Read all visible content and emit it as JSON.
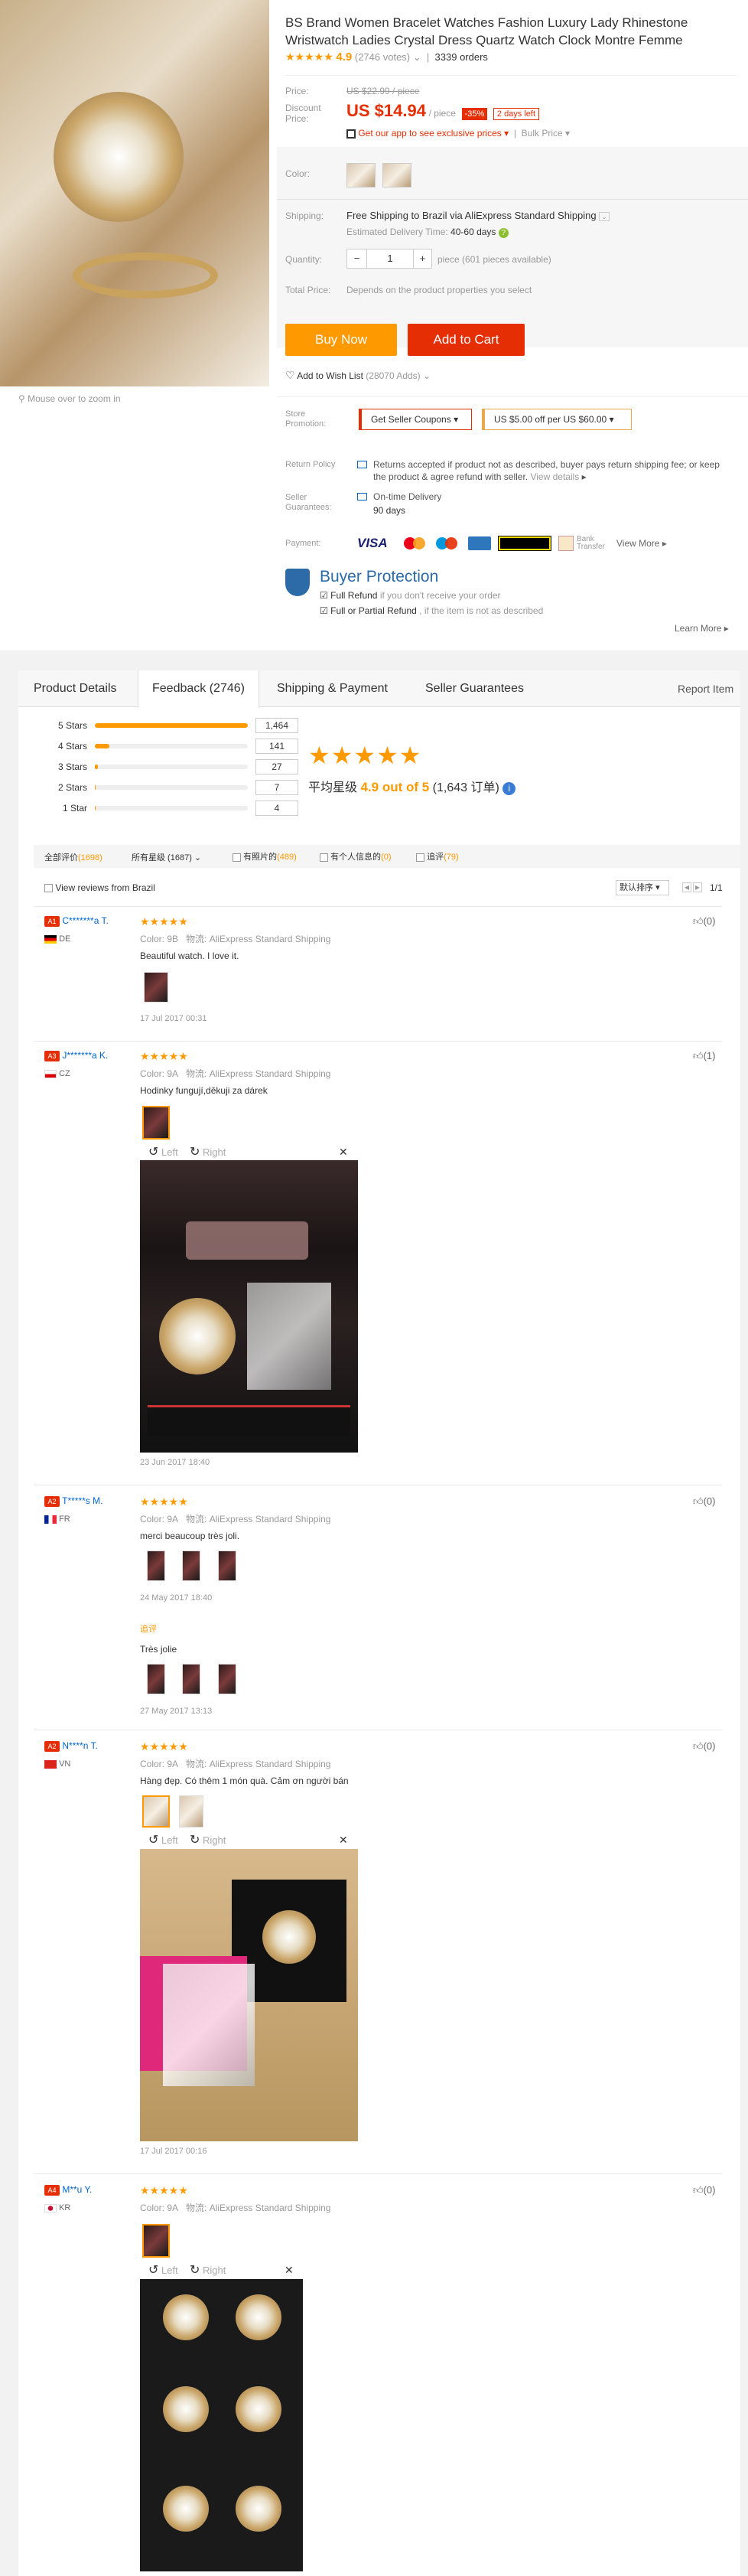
{
  "product": {
    "title": "BS Brand Women Bracelet Watches Fashion Luxury Lady Rhinestone Wristwatch Ladies Crystal Dress Quartz Watch Clock Montre Femme",
    "stars": "★★★★★",
    "rating": "4.9",
    "votes": "(2746 votes)",
    "orders": "3339 orders",
    "price_label": "Price:",
    "price_old": "US $22.99 / piece",
    "discount_label": "Discount Price:",
    "price_new": "US $14.94",
    "per_piece": "/ piece",
    "discount_pct": "-35%",
    "days_left": "2 days left",
    "app_text": "Get our app to see exclusive prices",
    "bulk_price": "Bulk Price",
    "color_label": "Color:",
    "shipping_label": "Shipping:",
    "shipping_text": "Free Shipping to Brazil via AliExpress Standard Shipping",
    "delivery_label": "Estimated Delivery Time:",
    "delivery_value": "40-60 days",
    "quantity_label": "Quantity:",
    "quantity_value": "1",
    "pieces_available": "piece (601 pieces available)",
    "total_label": "Total Price:",
    "total_text": "Depends on the product properties you select",
    "buy_now": "Buy Now",
    "add_to_cart": "Add to Cart",
    "wishlist": "Add to Wish List",
    "wishlist_count": "(28070 Adds)",
    "zoom_hint": "Mouse over to zoom in",
    "store_promo_label": "Store Promotion:",
    "seller_coupons": "Get Seller Coupons",
    "coupon_text": "US $5.00 off per US $60.00",
    "return_label": "Return Policy",
    "return_text": "Returns accepted if product not as described, buyer pays return shipping fee; or keep the product & agree refund with seller.",
    "view_details": "View details",
    "seller_guar_label": "Seller Guarantees:",
    "on_time": "On-time Delivery",
    "days90": "90 days",
    "payment_label": "Payment:",
    "bank_transfer": "Bank Transfer",
    "view_more": "View More",
    "buyer_protection": "Buyer Protection",
    "full_refund": "Full Refund",
    "full_refund_text": "if you don't receive your order",
    "partial_refund": "Full or Partial Refund",
    "partial_refund_text": ", if the item is not as described",
    "learn_more": "Learn More"
  },
  "tabs": [
    "Product Details",
    "Feedback (2746)",
    "Shipping & Payment",
    "Seller Guarantees"
  ],
  "report_item": "Report Item",
  "chart_data": {
    "type": "bar",
    "categories": [
      "5 Stars",
      "4 Stars",
      "3 Stars",
      "2 Stars",
      "1 Star"
    ],
    "values": [
      1464,
      141,
      27,
      7,
      4
    ],
    "xlim": [
      0,
      1464
    ]
  },
  "summary": {
    "stars": "★★★★★",
    "avg_label": "平均星级",
    "avg_value": "4.9 out of 5",
    "avg_count": "(1,643 订单)"
  },
  "filters": {
    "all": "全部评价",
    "all_count": "(1698)",
    "stars_select": "所有星级 (1687)",
    "with_photo": "有照片的",
    "with_photo_count": "(489)",
    "with_info": "有个人信息的",
    "with_info_count": "(0)",
    "followup": "追评",
    "followup_count": "(79)",
    "view_brazil": "View reviews from Brazil",
    "sort": "默认排序",
    "page": "1/1"
  },
  "reviews": [
    {
      "badge": "A1",
      "name": "C*******a T.",
      "country": "DE",
      "stars": "★★★★★",
      "color": "Color: 9B",
      "logistics": "物流: AliExpress Standard Shipping",
      "text": "Beautiful watch. I love it.",
      "date": "17 Jul 2017 00:31",
      "likes": "(0)"
    },
    {
      "badge": "A3",
      "name": "J*******a K.",
      "country": "CZ",
      "stars": "★★★★★",
      "color": "Color: 9A",
      "logistics": "物流: AliExpress Standard Shipping",
      "text": "Hodinky fungují,děkuji za dárek",
      "date": "23 Jun 2017 18:40",
      "likes": "(1)",
      "left": "Left",
      "right": "Right"
    },
    {
      "badge": "A2",
      "name": "T*****s M.",
      "country": "FR",
      "stars": "★★★★★",
      "color": "Color: 9A",
      "logistics": "物流: AliExpress Standard Shipping",
      "text": "merci beaucoup très joli.",
      "date": "24 May 2017 18:40",
      "likes": "(0)",
      "followup_label": "追评",
      "followup_text": "Très jolie",
      "followup_date": "27 May 2017 13:13"
    },
    {
      "badge": "A2",
      "name": "N****n T.",
      "country": "VN",
      "stars": "★★★★★",
      "color": "Color: 9A",
      "logistics": "物流: AliExpress Standard Shipping",
      "text": "Hàng đẹp. Có thêm 1 món quà. Cảm ơn người bán",
      "date": "17 Jul 2017 00:16",
      "likes": "(0)",
      "left": "Left",
      "right": "Right"
    },
    {
      "badge": "A4",
      "name": "M**u Y.",
      "country": "KR",
      "stars": "★★★★★",
      "color": "Color: 9A",
      "logistics": "物流: AliExpress Standard Shipping",
      "likes": "(0)",
      "left": "Left",
      "right": "Right"
    }
  ]
}
